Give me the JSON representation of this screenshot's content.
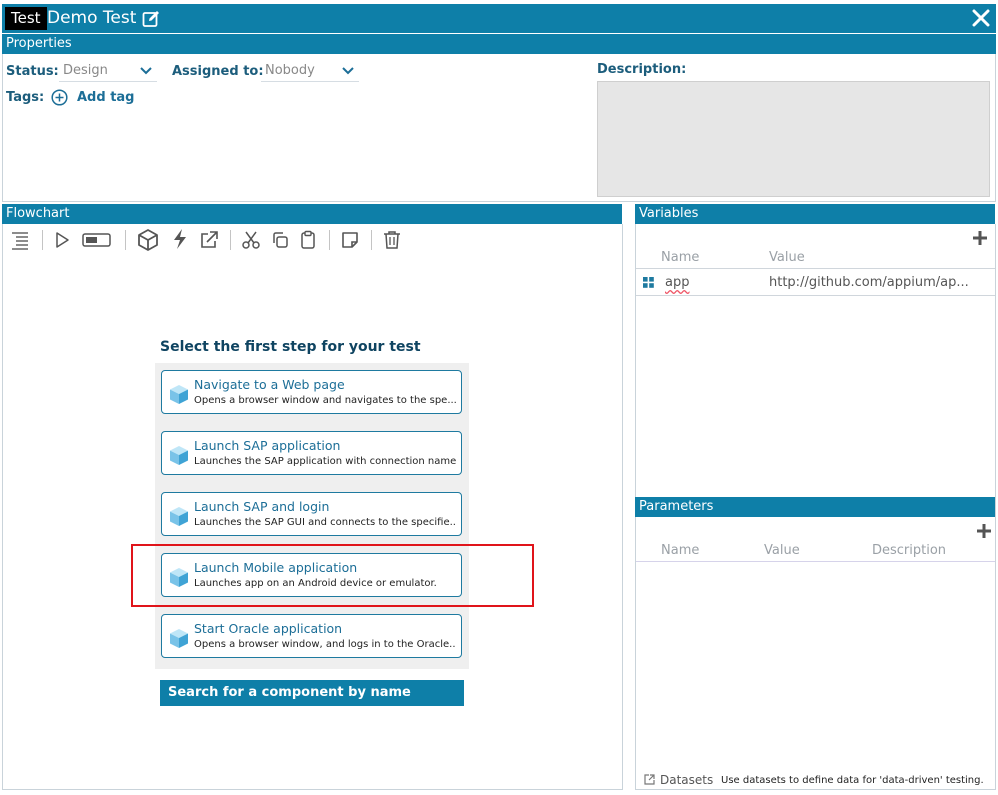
{
  "window": {
    "tag": "Test",
    "title": "Demo Test"
  },
  "properties": {
    "header": "Properties",
    "status_label": "Status:",
    "status_value": "Design",
    "assigned_label": "Assigned to:",
    "assigned_value": "Nobody",
    "tags_label": "Tags:",
    "add_tag_label": "Add tag",
    "description_label": "Description:"
  },
  "flowchart": {
    "header": "Flowchart",
    "toolbar_icons": [
      "list-icon",
      "play-icon",
      "toggle-icon",
      "package-icon",
      "lightning-icon",
      "external-link-icon",
      "cut-icon",
      "copy-icon",
      "paste-icon",
      "note-icon",
      "trash-icon"
    ],
    "first_step_title": "Select the first step for your test",
    "steps": [
      {
        "title": "Navigate to a Web page",
        "desc": "Opens a browser window and navigates to the spe..."
      },
      {
        "title": "Launch SAP application",
        "desc": "Launches the SAP application with connection name."
      },
      {
        "title": "Launch SAP and login",
        "desc": "Launches the SAP GUI and connects to the specifie..."
      },
      {
        "title": "Launch Mobile application",
        "desc": "Launches app on an Android device or emulator."
      },
      {
        "title": "Start Oracle application",
        "desc": "Opens a browser window, and logs in to the Oracle..."
      }
    ],
    "search_label": "Search for a component by name"
  },
  "variables": {
    "header": "Variables",
    "col_name": "Name",
    "col_value": "Value",
    "rows": [
      {
        "name": "app",
        "value": "http://github.com/appium/ap..."
      }
    ]
  },
  "parameters": {
    "header": "Parameters",
    "col_name": "Name",
    "col_value": "Value",
    "col_description": "Description"
  },
  "datasets": {
    "label": "Datasets",
    "hint": "Use datasets to define data for 'data-driven' testing."
  },
  "colors": {
    "accent": "#0e7fa8",
    "highlight": "#e0141a"
  }
}
